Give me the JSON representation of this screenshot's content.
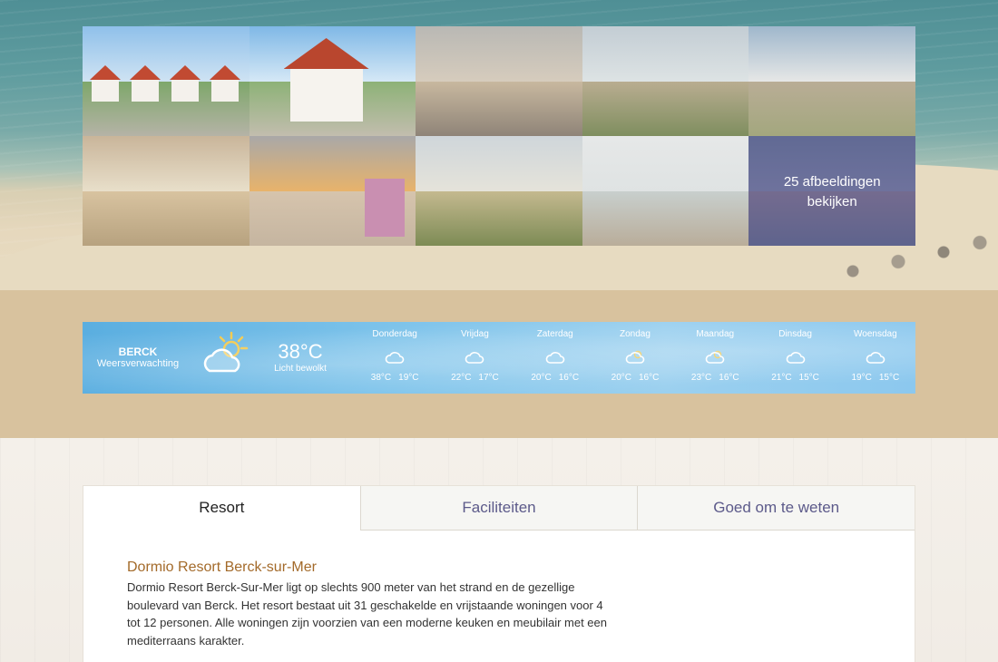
{
  "gallery": {
    "tiles": [
      {
        "name": "photo-holiday-houses"
      },
      {
        "name": "photo-white-villa"
      },
      {
        "name": "photo-beach-boulevard"
      },
      {
        "name": "photo-kite-festival"
      },
      {
        "name": "photo-dunes-coast"
      },
      {
        "name": "photo-beach-huts"
      },
      {
        "name": "photo-sunset-huts"
      },
      {
        "name": "photo-dune-path"
      },
      {
        "name": "photo-horse-riders"
      },
      {
        "name": "photo-town-street"
      }
    ],
    "more_label": "25 afbeeldingen bekijken"
  },
  "weather": {
    "city": "BERCK",
    "subtitle": "Weersverwachting",
    "current_temp": "38°C",
    "current_desc": "Licht bewolkt",
    "current_icon": "partly-cloudy-sun-icon",
    "days": [
      {
        "day": "Donderdag",
        "max": "38°C",
        "min": "19°C",
        "icon": "cloud-icon"
      },
      {
        "day": "Vrijdag",
        "max": "22°C",
        "min": "17°C",
        "icon": "cloud-icon"
      },
      {
        "day": "Zaterdag",
        "max": "20°C",
        "min": "16°C",
        "icon": "cloud-icon"
      },
      {
        "day": "Zondag",
        "max": "20°C",
        "min": "16°C",
        "icon": "partly-cloudy-sun-icon"
      },
      {
        "day": "Maandag",
        "max": "23°C",
        "min": "16°C",
        "icon": "partly-cloudy-sun-icon"
      },
      {
        "day": "Dinsdag",
        "max": "21°C",
        "min": "15°C",
        "icon": "cloud-icon"
      },
      {
        "day": "Woensdag",
        "max": "19°C",
        "min": "15°C",
        "icon": "cloud-icon"
      }
    ]
  },
  "tabs": [
    {
      "label": "Resort",
      "active": true
    },
    {
      "label": "Faciliteiten",
      "active": false
    },
    {
      "label": "Goed om te weten",
      "active": false
    }
  ],
  "content": {
    "title": "Dormio Resort Berck-sur-Mer",
    "body": "Dormio Resort Berck-Sur-Mer ligt op slechts 900 meter van het strand en de gezellige boulevard van Berck. Het resort bestaat uit 31 geschakelde en vrijstaande woningen voor 4 tot 12 personen. Alle woningen zijn voorzien van een moderne keuken en meubilair met een mediterraans karakter."
  },
  "colors": {
    "tan_band": "#d8c29e",
    "title_accent": "#a36a2a",
    "tab_text": "#5c5a8a",
    "weather_blue": "#7bc2ea"
  }
}
